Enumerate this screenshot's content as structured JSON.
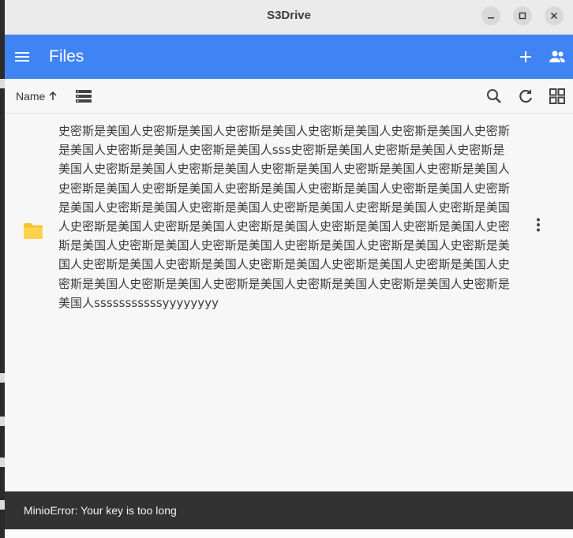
{
  "window": {
    "title": "S3Drive"
  },
  "appbar": {
    "title": "Files"
  },
  "toolbar": {
    "sort_label": "Name"
  },
  "files": [
    {
      "name": "史密斯是美国人史密斯是美国人史密斯是美国人史密斯是美国人史密斯是美国人史密斯是美国人史密斯是美国人史密斯是美国人sss史密斯是美国人史密斯是美国人史密斯是美国人史密斯是美国人史密斯是美国人史密斯是美国人史密斯是美国人史密斯是美国人史密斯是美国人史密斯是美国人史密斯是美国人史密斯是美国人史密斯是美国人史密斯是美国人史密斯是美国人史密斯是美国人史密斯是美国人史密斯是美国人史密斯是美国人史密斯是美国人史密斯是美国人史密斯是美国人史密斯是美国人史密斯是美国人史密斯是美国人史密斯是美国人史密斯是美国人史密斯是美国人史密斯是美国人史密斯是美国人史密斯是美国人史密斯是美国人史密斯是美国人史密斯是美国人史密斯是美国人史密斯是美国人史密斯是美国人史密斯是美国人史密斯是美国人史密斯是美国人史密斯是美国人sssssssssssyyyyyyyy",
      "type": "folder"
    }
  ],
  "snackbar": {
    "message": "MinioError: Your key is too long"
  },
  "colors": {
    "appbar": "#3f84f2",
    "folder": "#f7c22b",
    "snackbar": "#323232"
  },
  "icons": {
    "menu": "hamburger-menu-icon",
    "add": "plus-icon",
    "people": "people-icon",
    "sort": "arrow-up-icon",
    "view": "list-view-icon",
    "search": "search-icon",
    "refresh": "refresh-icon",
    "grid": "grid-view-icon",
    "folder": "folder-icon",
    "more": "more-vert-icon"
  }
}
